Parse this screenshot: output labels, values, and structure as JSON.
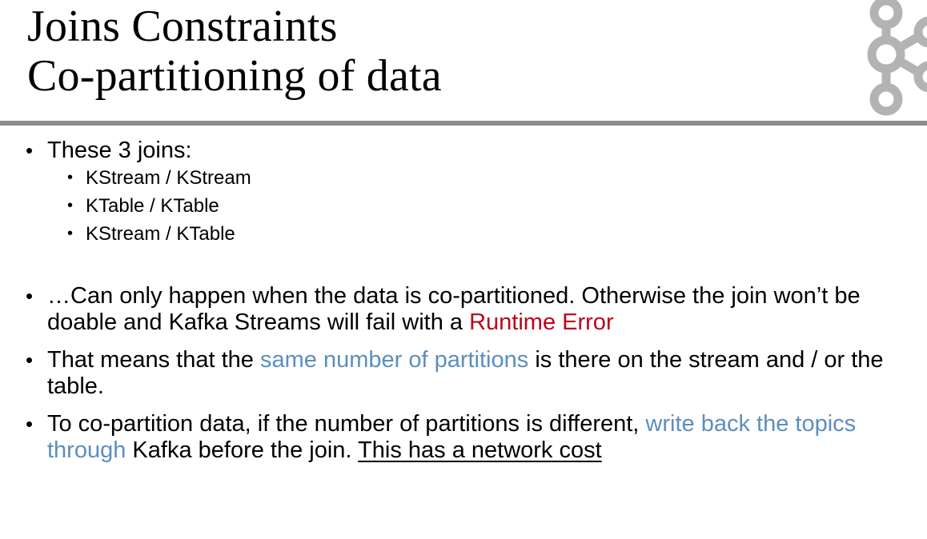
{
  "title": {
    "line1": "Joins Constraints",
    "line2": "Co-partitioning of data"
  },
  "logo": {
    "icon": "kafka-logo-icon",
    "color": "#b3b3b3"
  },
  "bullets": {
    "first": {
      "text": "These 3 joins:",
      "sub": [
        "KStream / KStream",
        "KTable / KTable",
        "KStream / KTable"
      ]
    },
    "second": {
      "text_a": "…Can only happen when the data is co-partitioned. Otherwise the join won’t be doable and Kafka Streams will fail with a ",
      "highlight": "Runtime Error"
    },
    "third": {
      "text_a": "That means that the ",
      "highlight": "same number of partitions",
      "text_b": " is there on the stream and / or the table."
    },
    "fourth": {
      "text_a": "To co-partition data, if the number of partitions is different, ",
      "highlight": "write back the topics through",
      "text_b": " Kafka before the join. ",
      "underlined": "This has a network cost"
    }
  },
  "colors": {
    "red": "#c00018",
    "blue": "#5b8fbf",
    "rule": "#8c8c8c"
  }
}
